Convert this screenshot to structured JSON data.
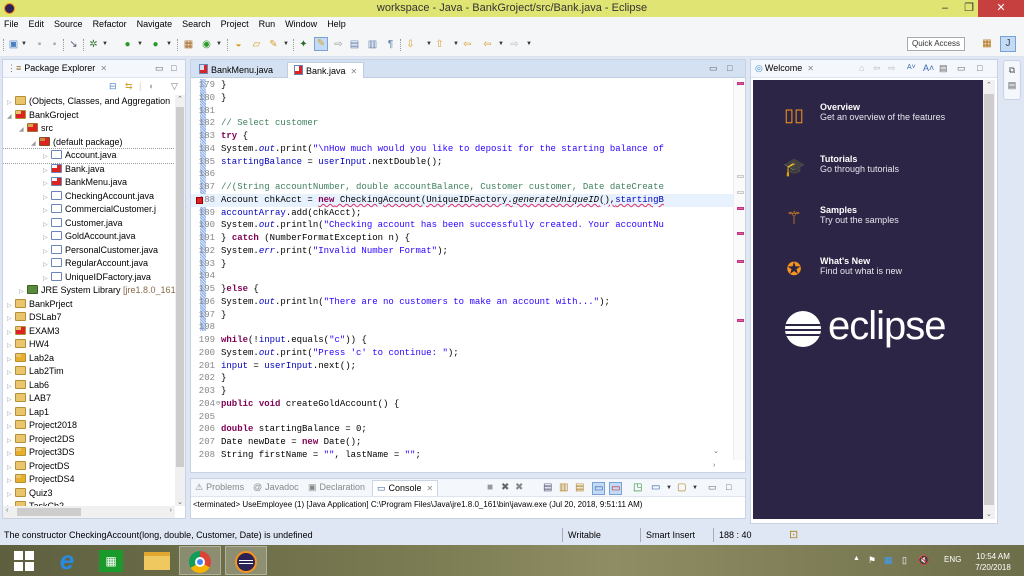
{
  "window": {
    "title": "workspace - Java - BankGroject/src/Bank.java - Eclipse",
    "minimize": "–",
    "maximize": "❐",
    "close": "✕"
  },
  "menu": [
    "File",
    "Edit",
    "Source",
    "Refactor",
    "Navigate",
    "Search",
    "Project",
    "Run",
    "Window",
    "Help"
  ],
  "toolbar": {
    "quick_access": "Quick Access"
  },
  "package_explorer": {
    "title": "Package Explorer",
    "items": [
      {
        "label": "(Objects, Classes, and Aggregation",
        "depth": 0,
        "icon": "proj",
        "expanded": false
      },
      {
        "label": "BankGroject",
        "depth": 0,
        "icon": "proj err",
        "expanded": true
      },
      {
        "label": "src",
        "depth": 1,
        "icon": "src err",
        "expanded": true
      },
      {
        "label": "(default package)",
        "depth": 2,
        "icon": "pkgi err",
        "expanded": true
      },
      {
        "label": "Account.java",
        "depth": 3,
        "icon": "java",
        "expanded": false,
        "selected": true
      },
      {
        "label": "Bank.java",
        "depth": 3,
        "icon": "java err",
        "expanded": false
      },
      {
        "label": "BankMenu.java",
        "depth": 3,
        "icon": "java err",
        "expanded": false
      },
      {
        "label": "CheckingAccount.java",
        "depth": 3,
        "icon": "java",
        "expanded": false
      },
      {
        "label": "CommercialCustomer.j",
        "depth": 3,
        "icon": "java",
        "expanded": false
      },
      {
        "label": "Customer.java",
        "depth": 3,
        "icon": "java",
        "expanded": false
      },
      {
        "label": "GoldAccount.java",
        "depth": 3,
        "icon": "java",
        "expanded": false
      },
      {
        "label": "PersonalCustomer.java",
        "depth": 3,
        "icon": "java",
        "expanded": false
      },
      {
        "label": "RegularAccount.java",
        "depth": 3,
        "icon": "java",
        "expanded": false
      },
      {
        "label": "UniqueIDFactory.java",
        "depth": 3,
        "icon": "java",
        "expanded": false
      },
      {
        "label": "JRE System Library",
        "suffix": " [jre1.8.0_161",
        "depth": 1,
        "icon": "lib",
        "expanded": false
      },
      {
        "label": "BankPrject",
        "depth": 0,
        "icon": "proj",
        "expanded": false
      },
      {
        "label": "DSLab7",
        "depth": 0,
        "icon": "proj",
        "expanded": false
      },
      {
        "label": "EXAM3",
        "depth": 0,
        "icon": "proj err",
        "expanded": false
      },
      {
        "label": "HW4",
        "depth": 0,
        "icon": "proj",
        "expanded": false
      },
      {
        "label": "Lab2a",
        "depth": 0,
        "icon": "proj warn",
        "expanded": false
      },
      {
        "label": "Lab2Tim",
        "depth": 0,
        "icon": "proj",
        "expanded": false
      },
      {
        "label": "Lab6",
        "depth": 0,
        "icon": "proj",
        "expanded": false
      },
      {
        "label": "LAB7",
        "depth": 0,
        "icon": "proj",
        "expanded": false
      },
      {
        "label": "Lap1",
        "depth": 0,
        "icon": "proj",
        "expanded": false
      },
      {
        "label": "Project2018",
        "depth": 0,
        "icon": "proj",
        "expanded": false
      },
      {
        "label": "Project2DS",
        "depth": 0,
        "icon": "proj",
        "expanded": false
      },
      {
        "label": "Project3DS",
        "depth": 0,
        "icon": "proj warn",
        "expanded": false
      },
      {
        "label": "ProjectDS",
        "depth": 0,
        "icon": "proj",
        "expanded": false
      },
      {
        "label": "ProjectDS4",
        "depth": 0,
        "icon": "proj warn",
        "expanded": false
      },
      {
        "label": "Quiz3",
        "depth": 0,
        "icon": "proj",
        "expanded": false
      },
      {
        "label": "TaskCh2",
        "depth": 0,
        "icon": "proj",
        "expanded": false
      }
    ]
  },
  "editor": {
    "tabs": [
      {
        "label": "BankMenu.java",
        "active": false
      },
      {
        "label": "Bank.java",
        "active": true
      }
    ],
    "lines": [
      {
        "n": "179",
        "html": "}"
      },
      {
        "n": "180",
        "html": "}"
      },
      {
        "n": "181",
        "html": ""
      },
      {
        "n": "182",
        "html": "<span class='cmt'>// Select customer</span>"
      },
      {
        "n": "183",
        "html": "<span class='kw'>try</span> {"
      },
      {
        "n": "184",
        "html": "System.<span class='fld'>out</span>.print(<span class='str'>\"\\nHow much would you like to deposit for the starting balance of</span>"
      },
      {
        "n": "185",
        "html": "<span class='var'>startingBalance</span> = <span class='var'>userInput</span>.nextDouble();"
      },
      {
        "n": "186",
        "html": ""
      },
      {
        "n": "187",
        "html": "<span class='cmt'>//(String accountNumber, double accountBalance, Customer customer, Date dateCreate</span>"
      },
      {
        "n": "188",
        "html": "Account chkAcct = <span class='err-underline'><span class='kw'>new</span> CheckingAccount(UniqueIDFactory.<i>generateUniqueID</i>(),<span class='var'>startingB</span></span>",
        "highlight": true,
        "error": true
      },
      {
        "n": "189",
        "html": "<span class='var'>accountArray</span>.add(chkAcct);"
      },
      {
        "n": "190",
        "html": "System.<span class='fld'>out</span>.println(<span class='str'>\"Checking account has been successfully created. Your accountNu</span>"
      },
      {
        "n": "191",
        "html": "} <span class='kw'>catch</span> (NumberFormatException n) {"
      },
      {
        "n": "192",
        "html": "System.<span class='fld'>err</span>.print(<span class='str'>\"Invalid Number Format\"</span>);"
      },
      {
        "n": "193",
        "html": "}"
      },
      {
        "n": "194",
        "html": ""
      },
      {
        "n": "195",
        "html": "}<span class='kw'>else</span> {"
      },
      {
        "n": "196",
        "html": "System.<span class='fld'>out</span>.println(<span class='str'>\"There are no customers to make an account with...\"</span>);"
      },
      {
        "n": "197",
        "html": "}"
      },
      {
        "n": "198",
        "html": ""
      },
      {
        "n": "199",
        "html": "<span class='kw'>while</span>(!<span class='var'>input</span>.equals(<span class='str'>\"c\"</span>)) {"
      },
      {
        "n": "200",
        "html": "System.<span class='fld'>out</span>.print(<span class='str'>\"Press 'c' to continue: \"</span>);"
      },
      {
        "n": "201",
        "html": "<span class='var'>input</span> = <span class='var'>userInput</span>.next();"
      },
      {
        "n": "202",
        "html": "}"
      },
      {
        "n": "203",
        "html": "}"
      },
      {
        "n": "204",
        "html": "<span class='kw'>public</span> <span class='kw'>void</span> createGoldAccount() {",
        "fold": true
      },
      {
        "n": "205",
        "html": ""
      },
      {
        "n": "206",
        "html": "<span class='kw'>double</span> startingBalance = 0;"
      },
      {
        "n": "207",
        "html": "Date newDate = <span class='kw'>new</span> Date();"
      },
      {
        "n": "208",
        "html": "String firstName = <span class='str'>\"\"</span>, lastName = <span class='str'>\"\"</span>;"
      }
    ]
  },
  "console": {
    "tabs": [
      {
        "label": "Problems",
        "icon": "⚠",
        "active": false
      },
      {
        "label": "Javadoc",
        "icon": "@",
        "active": false
      },
      {
        "label": "Declaration",
        "icon": "▣",
        "active": false
      },
      {
        "label": "Console",
        "icon": "▭",
        "active": true
      }
    ],
    "output": "<terminated> UseEmployee (1) [Java Application] C:\\Program Files\\Java\\jre1.8.0_161\\bin\\javaw.exe (Jul 20, 2018, 9:51:11 AM)"
  },
  "welcome": {
    "tab": "Welcome",
    "items": [
      {
        "title": "Overview",
        "desc": "Get an overview of the features",
        "icon": "map-icon"
      },
      {
        "title": "Tutorials",
        "desc": "Go through tutorials",
        "icon": "graduation-cap-icon"
      },
      {
        "title": "Samples",
        "desc": "Try out the samples",
        "icon": "magic-wand-icon"
      },
      {
        "title": "What's New",
        "desc": "Find out what is new",
        "icon": "star-icon"
      }
    ],
    "logo_text": "eclipse"
  },
  "statusbar": {
    "message": "The constructor CheckingAccount(long, double, Customer, Date) is undefined",
    "writable": "Writable",
    "insert_mode": "Smart Insert",
    "position": "188 : 40"
  },
  "taskbar": {
    "language": "ENG",
    "time": "10:54 AM",
    "date": "7/20/2018"
  },
  "colors": {
    "titlebar": "#dfe472",
    "welcome_bg": "#2c2545",
    "accent_orange": "#f7941e",
    "error_red": "#dd2222"
  }
}
